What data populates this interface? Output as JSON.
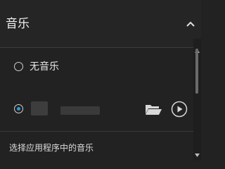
{
  "header": {
    "title": "音乐",
    "collapse_icon": "chevron-up-icon"
  },
  "options": [
    {
      "label": "无音乐",
      "selected": false
    },
    {
      "label": "",
      "selected": true,
      "folder_icon": "folder-icon",
      "play_icon": "play-icon"
    }
  ],
  "footer": {
    "text": "选择应用程序中的音乐"
  },
  "colors": {
    "accent": "#2f9bd6",
    "background": "#222222"
  }
}
